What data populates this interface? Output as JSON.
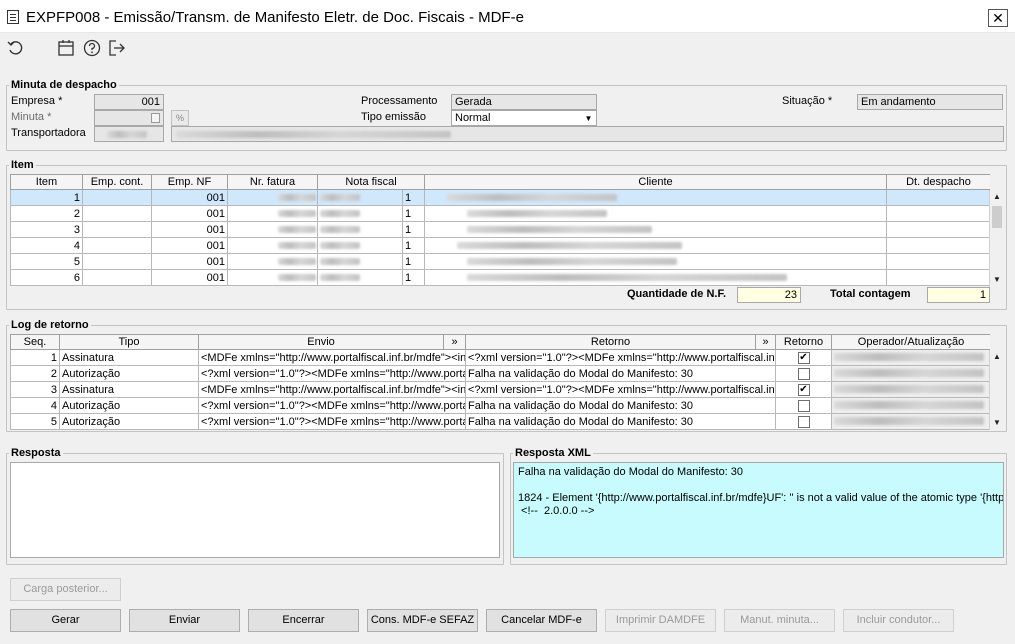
{
  "window": {
    "title": "EXPFP008 - Emissão/Transm. de Manifesto Eletr. de Doc. Fiscais - MDF-e",
    "close_glyph": "✕"
  },
  "toolbar": {
    "icons": [
      "refresh-icon",
      "calendar-icon",
      "help-icon",
      "exit-icon"
    ]
  },
  "minuta": {
    "group_label": "Minuta de despacho",
    "empresa_label": "Empresa *",
    "empresa_value": "001",
    "minuta_label": "Minuta *",
    "transportadora_label": "Transportadora",
    "processamento_label": "Processamento",
    "processamento_value": "Gerada",
    "tipo_emissao_label": "Tipo emissão",
    "tipo_emissao_value": "Normal",
    "situacao_label": "Situação *",
    "situacao_value": "Em andamento"
  },
  "item": {
    "group_label": "Item",
    "columns": [
      "Item",
      "Emp. cont.",
      "Emp. NF",
      "Nr. fatura",
      "Nota fiscal",
      "Cliente",
      "Dt. despacho"
    ],
    "rows": [
      {
        "item": "1",
        "emp_nf": "001",
        "nota": "1"
      },
      {
        "item": "2",
        "emp_nf": "001",
        "nota": "1"
      },
      {
        "item": "3",
        "emp_nf": "001",
        "nota": "1"
      },
      {
        "item": "4",
        "emp_nf": "001",
        "nota": "1"
      },
      {
        "item": "5",
        "emp_nf": "001",
        "nota": "1"
      },
      {
        "item": "6",
        "emp_nf": "001",
        "nota": "1"
      }
    ],
    "quantidade_label": "Quantidade de N.F.",
    "quantidade_value": "23",
    "total_label": "Total contagem",
    "total_value": "1"
  },
  "log": {
    "group_label": "Log de retorno",
    "columns": [
      "Seq.",
      "Tipo",
      "Envio",
      "»",
      "Retorno",
      "»",
      "Retorno",
      "Operador/Atualização"
    ],
    "rows": [
      {
        "seq": "1",
        "tipo": "Assinatura",
        "envio": "<MDFe xmlns=\"http://www.portalfiscal.inf.br/mdfe\"><in",
        "retorno": "<?xml version=\"1.0\"?><MDFe xmlns=\"http://www.portalfiscal.in",
        "checked": "✔"
      },
      {
        "seq": "2",
        "tipo": "Autorização",
        "envio": "<?xml version=\"1.0\"?><MDFe xmlns=\"http://www.portal",
        "retorno": "Falha na validação do Modal do Manifesto: 30",
        "checked": ""
      },
      {
        "seq": "3",
        "tipo": "Assinatura",
        "envio": "<MDFe xmlns=\"http://www.portalfiscal.inf.br/mdfe\"><in",
        "retorno": "<?xml version=\"1.0\"?><MDFe xmlns=\"http://www.portalfiscal.in",
        "checked": "✔"
      },
      {
        "seq": "4",
        "tipo": "Autorização",
        "envio": "<?xml version=\"1.0\"?><MDFe xmlns=\"http://www.portal",
        "retorno": "Falha na validação do Modal do Manifesto: 30",
        "checked": ""
      },
      {
        "seq": "5",
        "tipo": "Autorização",
        "envio": "<?xml version=\"1.0\"?><MDFe xmlns=\"http://www.portal",
        "retorno": "Falha na validação do Modal do Manifesto: 30",
        "checked": ""
      }
    ]
  },
  "resposta": {
    "group_label": "Resposta"
  },
  "resposta_xml": {
    "group_label": "Resposta XML",
    "text": "Falha na validação do Modal do Manifesto: 30\n\n1824 - Element '{http://www.portalfiscal.inf.br/mdfe}UF': '' is not a valid value of the atomic type '{http:\n <!--  2.0.0.0 -->"
  },
  "buttons": {
    "carga_posterior": "Carga posterior...",
    "gerar": "Gerar",
    "enviar": "Enviar",
    "encerrar": "Encerrar",
    "cons_sefaz": "Cons. MDF-e SEFAZ",
    "cancelar": "Cancelar MDF-e",
    "imprimir": "Imprimir DAMDFE",
    "manut": "Manut. minuta...",
    "incluir": "Incluir condutor..."
  }
}
